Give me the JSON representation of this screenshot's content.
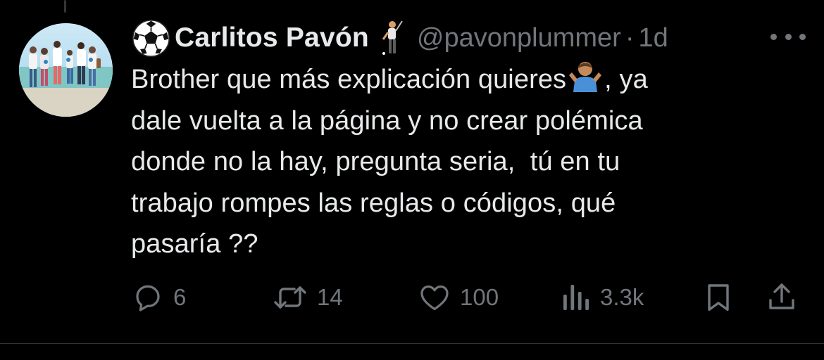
{
  "tweet": {
    "author": {
      "display_name": "Carlitos Pavón",
      "handle": "@pavonplummer",
      "name_prefix_emoji": "soccer-ball-icon",
      "name_suffix_emoji": "golfer-icon"
    },
    "separator": "·",
    "timestamp": "1d",
    "text_lines": [
      {
        "before": "Brother que más explicación quieres",
        "emoji": "person-shrugging-icon",
        "after": ", ya"
      },
      "dale vuelta a la página y no crear polémica",
      "donde no la hay, pregunta seria,  tú en tu",
      "trabajo rompes las reglas o códigos, qué",
      "pasaría ??"
    ],
    "actions": {
      "replies": "6",
      "reposts": "14",
      "likes": "100",
      "views": "3.3k"
    }
  },
  "colors": {
    "background": "#000000",
    "primary_text": "#e7e9ea",
    "secondary_text": "#71767b",
    "divider": "#2f3336"
  }
}
